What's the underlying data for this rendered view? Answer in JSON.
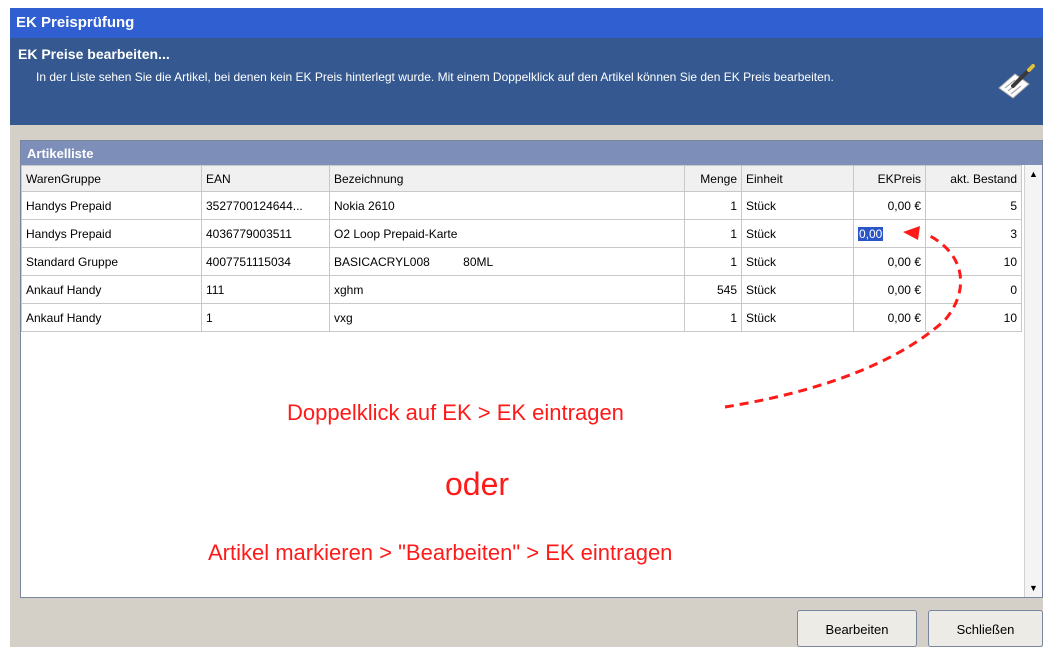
{
  "window": {
    "title": "EK Preisprüfung"
  },
  "header": {
    "title": "EK Preise bearbeiten...",
    "description": "In der Liste sehen Sie die Artikel, bei denen kein EK Preis hinterlegt wurde. Mit einem Doppelklick auf den Artikel können Sie den EK Preis bearbeiten."
  },
  "panel": {
    "title": "Artikelliste"
  },
  "table": {
    "columns": [
      "WarenGruppe",
      "EAN",
      "Bezeichnung",
      "Menge",
      "Einheit",
      "EKPreis",
      "akt. Bestand"
    ],
    "rows": [
      {
        "gruppe": "Handys Prepaid",
        "ean": "3527700124644...",
        "bez": "Nokia 2610",
        "menge": "1",
        "einheit": "Stück",
        "ek": "0,00 €",
        "bestand": "5"
      },
      {
        "gruppe": "Handys Prepaid",
        "ean": "4036779003511",
        "bez": "O2 Loop Prepaid-Karte",
        "menge": "1",
        "einheit": "Stück",
        "ek": "0,00",
        "bestand": "3"
      },
      {
        "gruppe": "Standard Gruppe",
        "ean": "4007751115034",
        "bez": "BASICACRYL008          80ML",
        "menge": "1",
        "einheit": "Stück",
        "ek": "0,00 €",
        "bestand": "10"
      },
      {
        "gruppe": "Ankauf Handy",
        "ean": "111",
        "bez": "xghm",
        "menge": "545",
        "einheit": "Stück",
        "ek": "0,00 €",
        "bestand": "0"
      },
      {
        "gruppe": "Ankauf Handy",
        "ean": "1",
        "bez": "vxg",
        "menge": "1",
        "einheit": "Stück",
        "ek": "0,00 €",
        "bestand": "10"
      }
    ]
  },
  "annotations": {
    "line1": "Doppelklick auf EK > EK eintragen",
    "line2": "oder",
    "line3": "Artikel markieren > \"Bearbeiten\" > EK eintragen",
    "color": "#ff1a1a"
  },
  "buttons": {
    "edit": "Bearbeiten",
    "close": "Schließen"
  },
  "icons": {
    "header": "notepad-pen-icon",
    "scroll_up": "arrow-up-icon",
    "scroll_down": "arrow-down-icon"
  }
}
